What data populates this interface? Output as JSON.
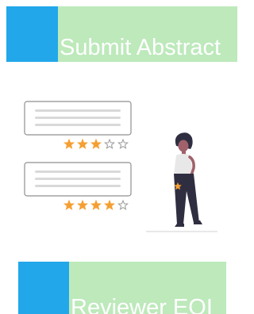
{
  "buttons": {
    "submit_abstract": "Submit Abstract",
    "reviewer_eoi": "Reviewer EOI"
  },
  "colors": {
    "accent_blue": "#21a7ea",
    "button_green": "#bde9bb",
    "star_filled": "#f59f33",
    "card_border": "#8f8f8f",
    "card_line": "#d9d9d9",
    "figure_dark": "#2f2e41"
  },
  "illustration": {
    "review_cards": [
      {
        "rating": 3,
        "out_of": 5
      },
      {
        "rating": 4,
        "out_of": 5
      }
    ],
    "figure": "person-holding-star"
  }
}
